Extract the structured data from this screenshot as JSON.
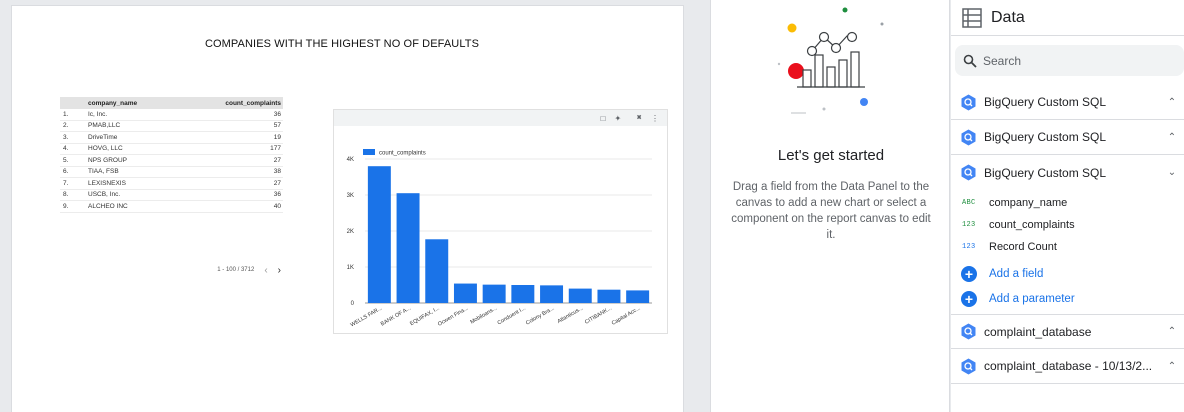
{
  "report": {
    "title": "COMPANIES WITH THE HIGHEST NO OF DEFAULTS"
  },
  "table": {
    "headers": {
      "name": "company_name",
      "value": "count_complaints"
    },
    "rows": [
      {
        "num": "1.",
        "name": "Ic, Inc.",
        "value": "36"
      },
      {
        "num": "2.",
        "name": "PMAB,LLC",
        "value": "57"
      },
      {
        "num": "3.",
        "name": "DriveTime",
        "value": "19"
      },
      {
        "num": "4.",
        "name": "HOVG, LLC",
        "value": "177"
      },
      {
        "num": "5.",
        "name": "NPS GROUP",
        "value": "27"
      },
      {
        "num": "6.",
        "name": "TIAA, FSB",
        "value": "38"
      },
      {
        "num": "7.",
        "name": "LEXISNEXIS",
        "value": "27"
      },
      {
        "num": "8.",
        "name": "USCB, Inc.",
        "value": "36"
      },
      {
        "num": "9.",
        "name": "ALCHEO INC",
        "value": "40"
      }
    ],
    "pagination": "1 - 100 / 3712"
  },
  "chart_data": {
    "type": "bar",
    "legend": "count_complaints",
    "categories": [
      "WELLS FAR...",
      "BANK OF A...",
      "EQUIFAX, I...",
      "Ocwen Fina...",
      "Mobiloans...",
      "Conduent I...",
      "Colony Bra...",
      "Atlanticus...",
      "CITIBANK...",
      "Capital Acc..."
    ],
    "values": [
      3800,
      3050,
      1770,
      540,
      510,
      500,
      490,
      400,
      370,
      350
    ],
    "y_ticks": [
      "0",
      "1K",
      "2K",
      "3K",
      "4K"
    ],
    "ylim": [
      0,
      4000
    ],
    "bar_color": "#1a73e8",
    "grid": true
  },
  "chart_toolbar": {
    "icons": [
      "select-icon",
      "magic-icon",
      "lightning-icon",
      "more-vert-icon"
    ]
  },
  "middle_panel": {
    "title": "Let's get started",
    "description": "Drag a field from the Data Panel to the canvas to add a new chart or select a component on the report canvas to edit it."
  },
  "data_panel": {
    "title": "Data",
    "search_placeholder": "Search",
    "sources": [
      {
        "name": "BigQuery Custom SQL",
        "expanded": false
      },
      {
        "name": "BigQuery Custom SQL",
        "expanded": false
      },
      {
        "name": "BigQuery Custom SQL",
        "expanded": true
      }
    ],
    "fields": [
      {
        "type": "ABC",
        "name": "company_name"
      },
      {
        "type": "123",
        "name": "count_complaints"
      },
      {
        "type": "123",
        "name": "Record Count"
      }
    ],
    "add_field": "Add a field",
    "add_parameter": "Add a parameter",
    "other_sources": [
      {
        "name": "complaint_database"
      },
      {
        "name": "complaint_database - 10/13/2..."
      }
    ]
  },
  "colors": {
    "accent": "#1a73e8",
    "green": "#1e8e3e",
    "red": "#ea0f1c",
    "yellow": "#fbbc04"
  }
}
